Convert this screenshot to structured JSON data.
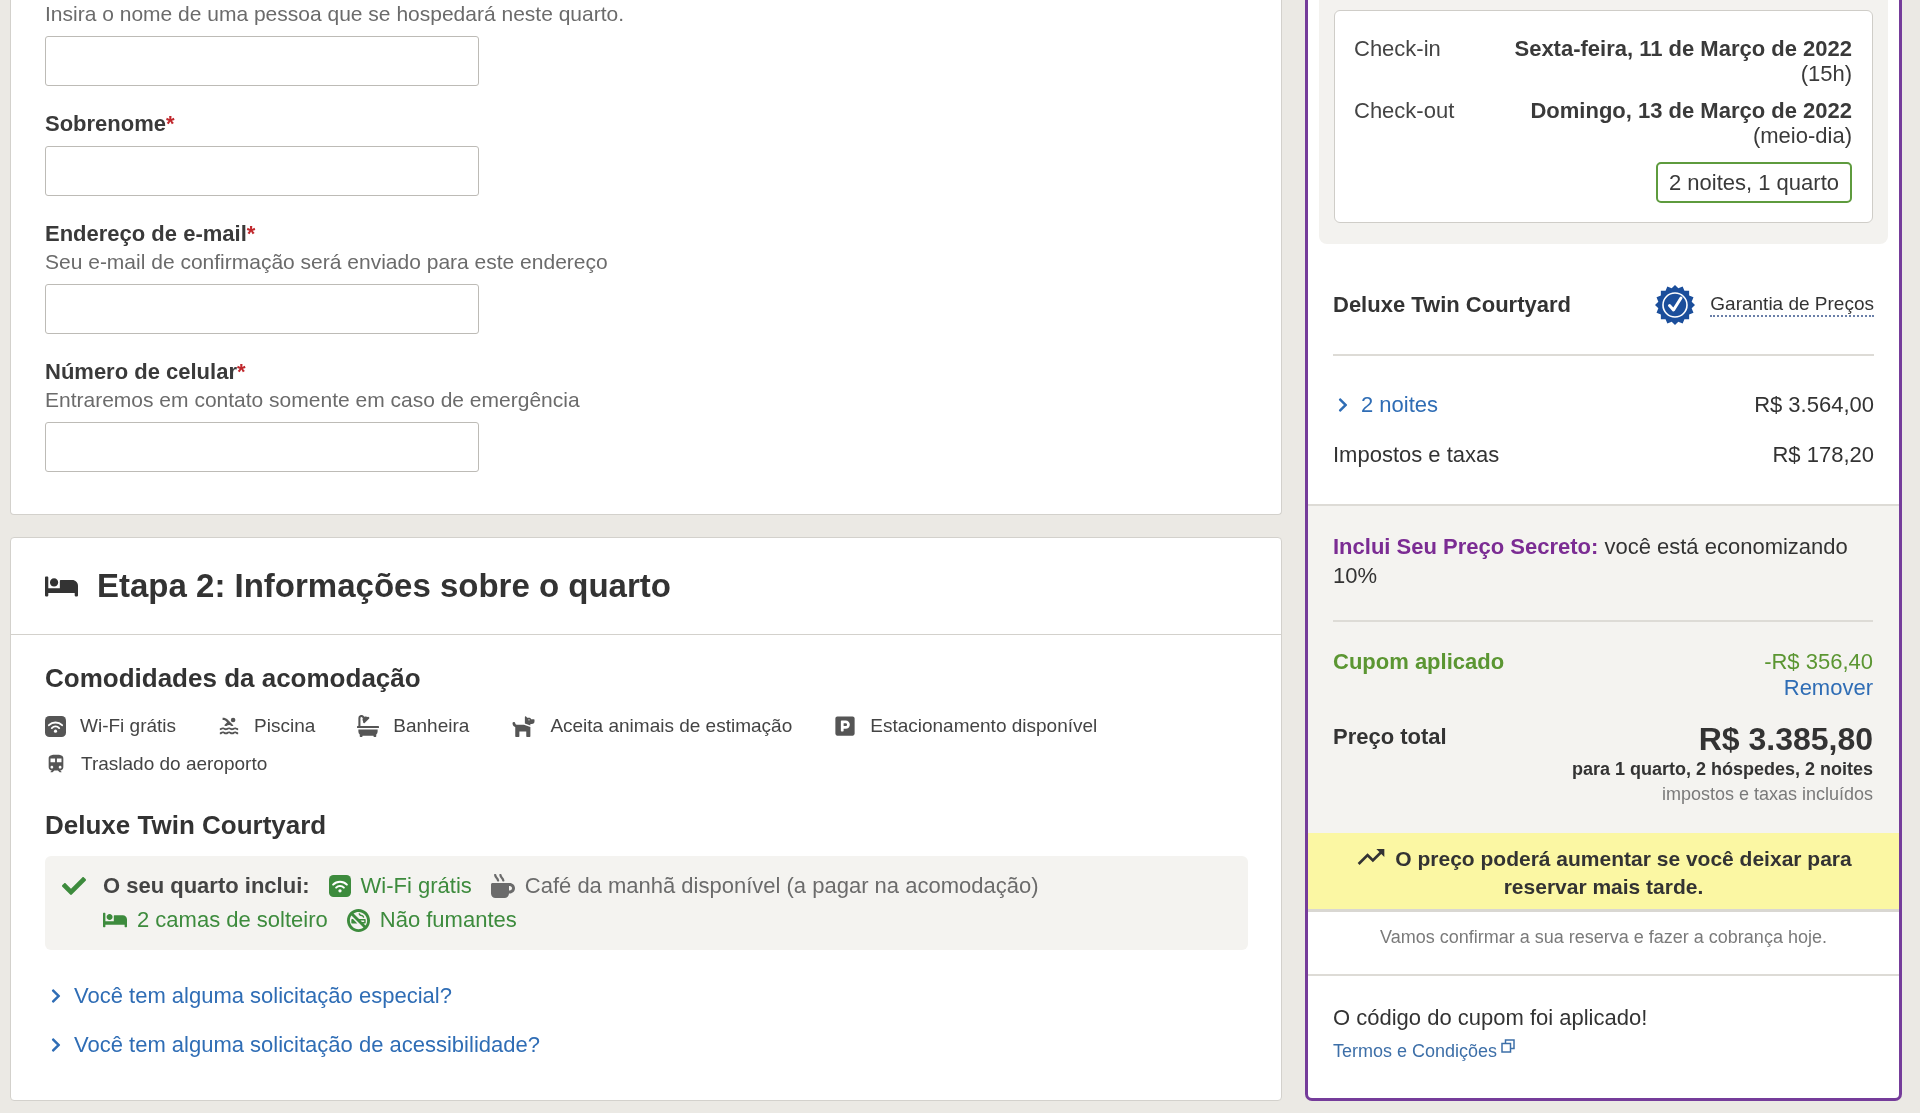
{
  "guest_form": {
    "fields": [
      {
        "hint": "Insira o nome de uma pessoa que se hospedará neste quarto."
      },
      {
        "label": "Sobrenome",
        "required_mark": "*"
      },
      {
        "label": "Endereço de e-mail",
        "required_mark": "*",
        "hint": "Seu e-mail de confirmação será enviado para este endereço"
      },
      {
        "label": "Número de celular",
        "required_mark": "*",
        "hint": "Entraremos em contato somente em caso de emergência"
      }
    ]
  },
  "room_step": {
    "title": "Etapa 2: Informações sobre o quarto",
    "amenities_heading": "Comodidades da acomodação",
    "amenities": [
      "Wi-Fi grátis",
      "Piscina",
      "Banheira",
      "Aceita animais de estimação",
      "Estacionamento disponível",
      "Traslado do aeroporto"
    ],
    "room_name": "Deluxe Twin Courtyard",
    "includes": {
      "label": "O seu quarto inclui:",
      "items": [
        {
          "text": "Wi-Fi grátis",
          "color": "#3d8b3d"
        },
        {
          "text": "Café da manhã disponível (a pagar na acomodação)",
          "color": "#6b6b6b"
        },
        {
          "text": "2 camas de solteiro",
          "color": "#3d8b3d"
        },
        {
          "text": "Não fumantes",
          "color": "#3d8b3d"
        }
      ]
    },
    "links": [
      {
        "text": "Você tem alguma solicitação especial?",
        "expanded": false
      },
      {
        "text": "Você tem alguma solicitação de acessibilidade?",
        "expanded": false
      }
    ]
  },
  "summary": {
    "check_in": {
      "label": "Check-in",
      "date": "Sexta-feira, 11 de Março de 2022",
      "time": "(15h)"
    },
    "check_out": {
      "label": "Check-out",
      "date": "Domingo, 13 de Março de 2022",
      "time": "(meio-dia)"
    },
    "stay": "2 noites, 1 quarto",
    "room_name": "Deluxe Twin Courtyard",
    "guarantee": "Garantia de Preços",
    "nights": {
      "label": "2 noites",
      "price": "R$ 3.564,00",
      "expanded": false
    },
    "taxes": {
      "label": "Impostos e taxas",
      "price": "R$ 178,20"
    },
    "secret_price": "**Inclui Seu Preço Secreto:** você está economizando 10%",
    "coupon": {
      "label": "Cupom aplicado",
      "amount": "-R$ 356,40",
      "remove": "Remover"
    },
    "total": {
      "label": "Preço total",
      "amount": "R$ 3.385,80",
      "details": "para 1 quarto, 2 hóspedes, 2 noites",
      "note": "impostos e taxas incluídos"
    },
    "price_alert": "O preço poderá aumentar se você deixar para reservar mais tarde.",
    "charge_note": "Vamos confirmar a sua reserva e fazer a cobrança hoje.",
    "coupon_message": "O código do cupom foi aplicado!",
    "terms_link": "Termos e Condições"
  }
}
